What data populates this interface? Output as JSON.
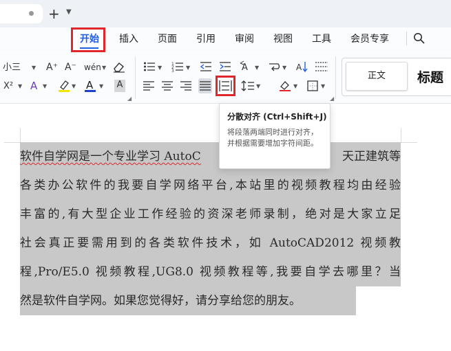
{
  "tabbar": {
    "new_tab": "+",
    "menu": "⌄"
  },
  "menu": {
    "tabs": [
      "开始",
      "插入",
      "页面",
      "引用",
      "审阅",
      "视图",
      "工具",
      "会员专享"
    ],
    "search_icon": "search-icon"
  },
  "toolbar": {
    "font_size": "小三",
    "grow_font": "A⁺",
    "shrink_font": "A⁻",
    "pinyin": "wén",
    "superscript": "X²",
    "font_color": "A",
    "highlight": "A",
    "char_shading": "A",
    "accent_color": "#1f5fe0"
  },
  "styles": {
    "normal": "正文",
    "heading": "标题"
  },
  "tooltip": {
    "title": "分散对齐 (Ctrl+Shift+J)",
    "body": "将段落两端同时进行对齐，并根据需要增加字符间距。"
  },
  "document": {
    "lines": [
      "软件自学网是一个专业学习 AutoC",
      "天正建筑等",
      "各类办公软件的我要自学网络平台,本站里的视频教程均由经验",
      "丰富的,有大型企业工作经验的资深老师录制，绝对是大家立足",
      "社会真正要需用到的各类软件技术，如 AutoCAD2012 视频教",
      "程,Pro/E5.0 视频教程,UG8.0 视频教程等,我要自学去哪里？当",
      "然是软件自学网。如果您觉得好，请分享给您的朋友。"
    ]
  }
}
